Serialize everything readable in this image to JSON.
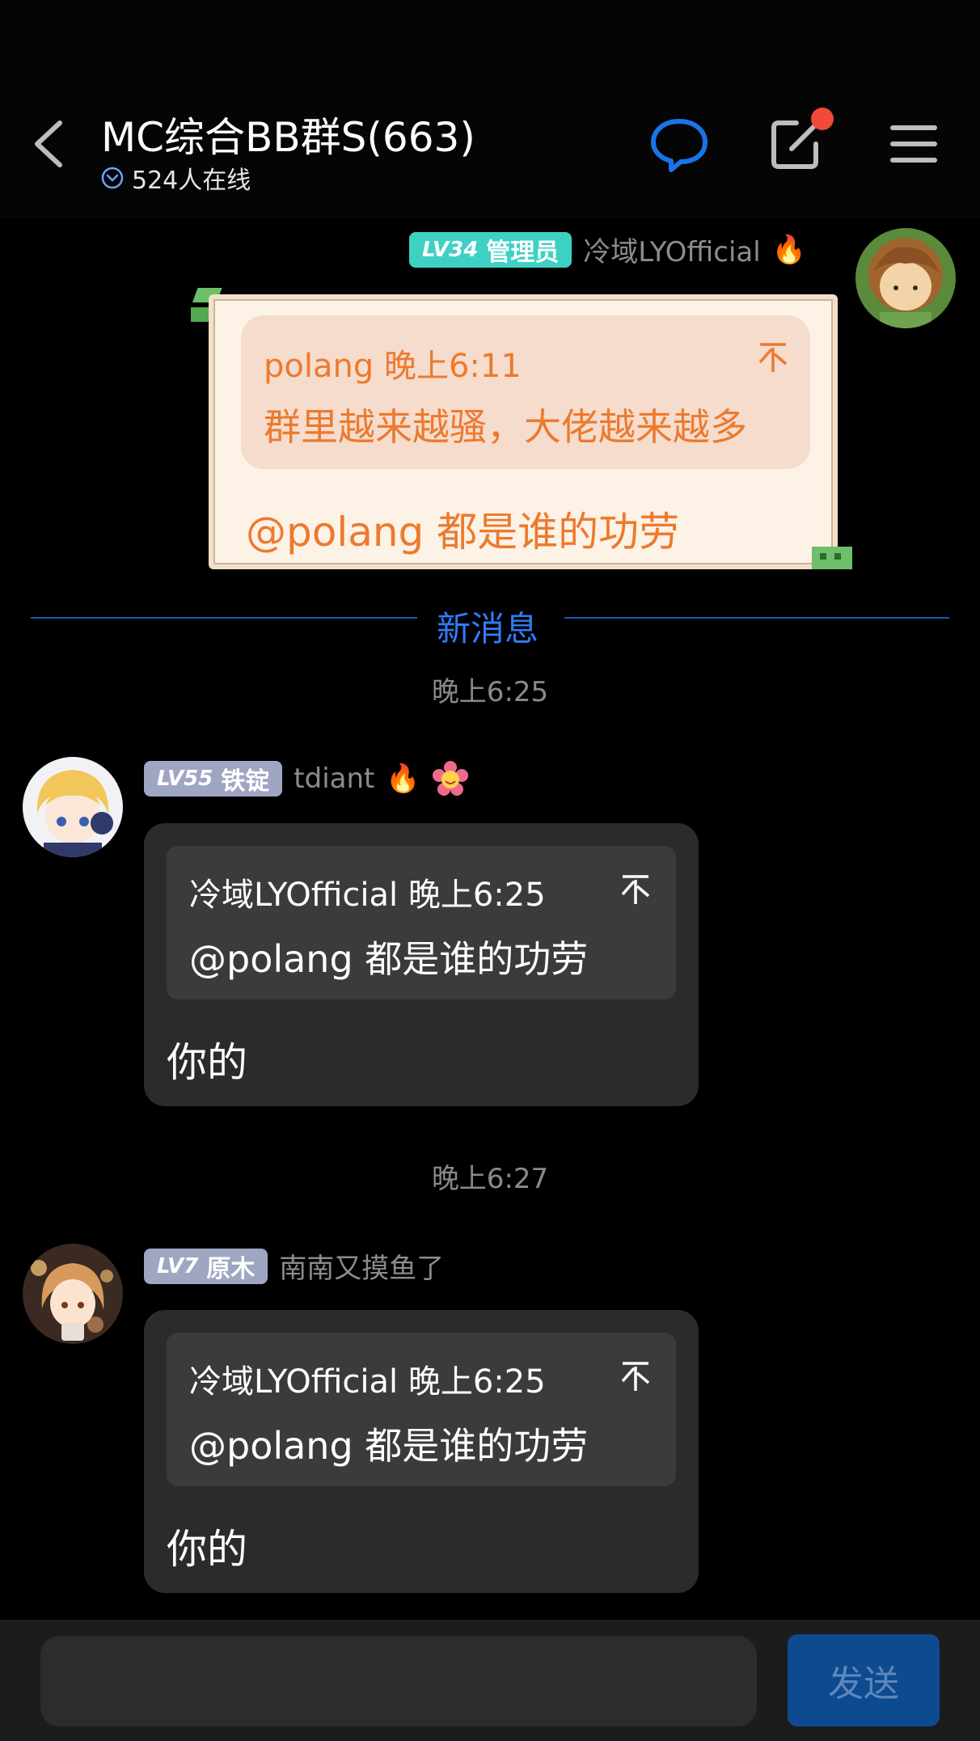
{
  "header": {
    "title": "MC综合BB群S(663)",
    "online_count": "524人在线",
    "icons": [
      "back-icon",
      "chat-bubble-icon",
      "edit-icon",
      "menu-icon"
    ],
    "accent_color": "#1a73e8"
  },
  "own_message": {
    "badge_level": "LV34",
    "badge_role": "管理员",
    "sender": "冷域LYOfficial",
    "sender_emoji": "🔥",
    "quote_header": "polang 晚上6:11",
    "quote_text": "群里越来越骚，大佬越来越多",
    "text": "@polang 都是谁的功劳"
  },
  "divider": {
    "label": "新消息"
  },
  "messages": [
    {
      "time": "晚上6:25",
      "badge_level": "LV55",
      "badge_title": "铁锭",
      "sender": "tdiant",
      "emojis": "🔥",
      "quote_header": "冷域LYOfficial 晚上6:25",
      "quote_text": "@polang 都是谁的功劳",
      "text": "你的"
    },
    {
      "time": "晚上6:27",
      "badge_level": "LV7",
      "badge_title": "原木",
      "sender": "南南又摸鱼了",
      "quote_header": "冷域LYOfficial 晚上6:25",
      "quote_text": "@polang 都是谁的功劳",
      "text": "你的"
    }
  ],
  "composer": {
    "placeholder": "",
    "send_label": "发送"
  }
}
